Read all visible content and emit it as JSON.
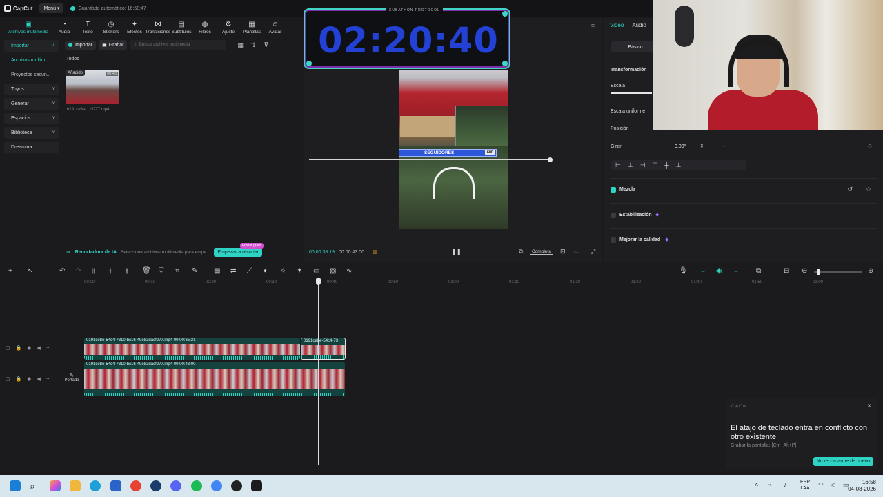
{
  "titlebar": {
    "app_name": "CapCut",
    "menu_label": "Menú",
    "autosave": "Guardado automático: 16:58:47"
  },
  "toolbar": {
    "items": [
      {
        "icon": "media-icon",
        "label": "Archivos multimedia"
      },
      {
        "icon": "audio-icon",
        "label": "Audio"
      },
      {
        "icon": "text-icon",
        "label": "Texto"
      },
      {
        "icon": "stickers-icon",
        "label": "Stickers"
      },
      {
        "icon": "effects-icon",
        "label": "Efectos"
      },
      {
        "icon": "transitions-icon",
        "label": "Transiciones"
      },
      {
        "icon": "subtitles-icon",
        "label": "Subtítulos"
      },
      {
        "icon": "filters-icon",
        "label": "Filtros"
      },
      {
        "icon": "adjust-icon",
        "label": "Ajuste"
      },
      {
        "icon": "templates-icon",
        "label": "Plantillas"
      },
      {
        "icon": "avatar-icon",
        "label": "Avatar"
      }
    ]
  },
  "leftnav": {
    "items": [
      "Importar",
      "Archivos multim...",
      "Proyectos secun...",
      "Tuyos",
      "Generar",
      "Espacios",
      "Biblioteca",
      "Dreamina"
    ]
  },
  "media": {
    "import_label": "Importar",
    "record_label": "Grabar",
    "search_placeholder": "Buscar archivos multimedia",
    "section": "Todos",
    "clip_tag": "Añadido",
    "clip_duration": "00:43",
    "clip_name": "0191ce8e-...cf277.mp4"
  },
  "iabar": {
    "title": "Recortadora de IA",
    "desc": "Selecciona archivos multimedia para empe...",
    "button": "Empezar a recortar",
    "badge": "Probar gratis"
  },
  "timer": {
    "title": "SUBATHON PROTOCOL",
    "value": "02:20:40"
  },
  "preview": {
    "followers_label": "SEGUIDORES",
    "followers_count": "600",
    "timecode_current": "00:00:38:19",
    "timecode_total": "00:00:43:00",
    "full_label": "Completa"
  },
  "rpanel": {
    "tab_video": "Video",
    "tab_audio": "Audio",
    "basic": "Básico",
    "transform": "Transformación",
    "scale": "Escala",
    "uniform_scale": "Escala uniforme",
    "position": "Posición",
    "rotate": "Girar",
    "rotate_value": "0.00°",
    "blend": "Mezcla",
    "stabilize": "Estabilización",
    "improve": "Mejorar la calidad"
  },
  "ruler": {
    "ticks": [
      "00:00",
      "00:10",
      "00:20",
      "00:30",
      "00:40",
      "00:50",
      "01:00",
      "01:10",
      "01:20",
      "01:30",
      "01:40",
      "01:50",
      "02:00"
    ]
  },
  "tracks": {
    "clip1_label": "0191ce8e-54c4-7310-bc16-49e83dacf277.mp4  00:00:35:21",
    "clip1b_label": "0191ce8e-54c4-73",
    "clip2_label": "0191ce8e-54c4-7310-bc16-49e83dacf277.mp4  00:00:43:00",
    "cover_label": "Portada"
  },
  "toast": {
    "app": "CapCut",
    "message": "El atajo de teclado entra en conflicto con otro existente",
    "sub": "Grabar la pantalla: [Ctrl+Alt+P]",
    "button": "No recordarme de nuevo"
  },
  "taskbar": {
    "lang_top": "ESP",
    "lang_bottom": "LAA",
    "time": "16:58",
    "date": "04-08-2026"
  },
  "colors": {
    "accent": "#2fd3c4",
    "timer_blue": "#2441d6",
    "followers_blue": "#2d56d8"
  }
}
